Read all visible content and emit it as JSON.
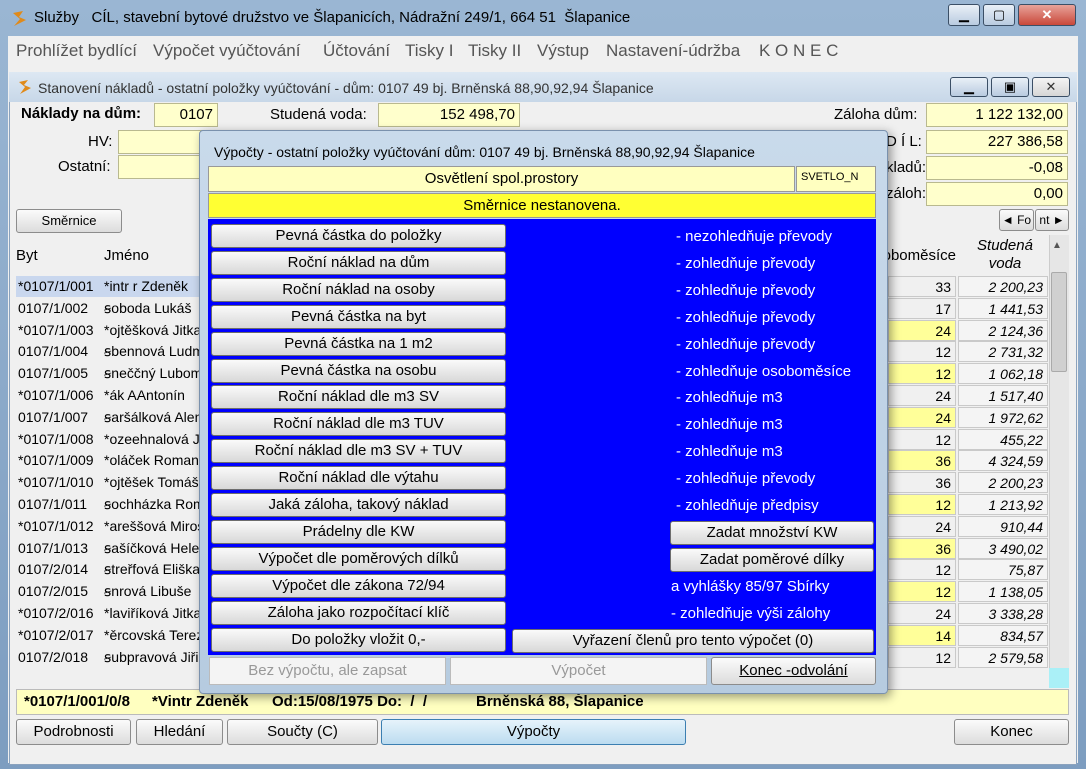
{
  "outer": {
    "title": "Služby   CÍL, stavební bytové družstvo ve Šlapanicích, Nádražní 249/1, 664 51  Šlapanice"
  },
  "menu": [
    "Prohlížet bydlící",
    "Výpočet vyúčtování",
    "Účtování",
    "Tisky I",
    "Tisky II",
    "Výstup",
    "Nastavení-údržba",
    "K O N E C"
  ],
  "inner": {
    "title": "Stanovení nákladů - ostatní položky vyúčtování - dům: 0107  49 bj. Brněnská 88,90,92,94 Šlapanice"
  },
  "form": {
    "naklady_label": "Náklady na dům:",
    "naklady_value": "0107",
    "studena_label": "Studená voda:",
    "studena_value": "152 498,70",
    "zaloha_label": "Záloha dům:",
    "zaloha_value": "1 122 132,00",
    "hv_label": "HV:",
    "ostatni_label": "Ostatní:",
    "r2_label": "D Í L:",
    "r2_value": "227 386,58",
    "r3_label": "kladů:",
    "r3_value": "-0,08",
    "r4_label": "záloh:",
    "r4_value": "0,00",
    "smernice_button": "Směrnice",
    "nav_prev": "◄ Fo",
    "nav_next": "nt ►"
  },
  "table": {
    "headers": {
      "byt": "Byt",
      "jmeno": "Jméno",
      "osobomesice": "Osoboměsíce",
      "studena1": "Studená",
      "studena2": "voda"
    },
    "rows": [
      {
        "byt": "*0107/1/001",
        "jmeno": "*intr r Zdeněk",
        "os": "33",
        "sv": "2 200,23",
        "hl": false
      },
      {
        "byt": "0107/1/002",
        "jmeno": "ꞩoboda Lukáš",
        "os": "17",
        "sv": "1 441,53",
        "hl": false
      },
      {
        "byt": "*0107/1/003",
        "jmeno": "*ojtěšková Jitka",
        "os": "24",
        "sv": "2 124,36",
        "hl": true
      },
      {
        "byt": "0107/1/004",
        "jmeno": "ꞩbennová Ludmila",
        "os": "12",
        "sv": "2 731,32",
        "hl": false
      },
      {
        "byt": "0107/1/005",
        "jmeno": "ꞩneččný Lubomír",
        "os": "12",
        "sv": "1 062,18",
        "hl": true
      },
      {
        "byt": "*0107/1/006",
        "jmeno": "*ák AAntonín",
        "os": "24",
        "sv": "1 517,40",
        "hl": false
      },
      {
        "byt": "0107/1/007",
        "jmeno": "ꞩaršálková Alena",
        "os": "24",
        "sv": "1 972,62",
        "hl": true
      },
      {
        "byt": "*0107/1/008",
        "jmeno": "*ozeehnalová Jana",
        "os": "12",
        "sv": "455,22",
        "hl": false
      },
      {
        "byt": "*0107/1/009",
        "jmeno": "*oláček Roman",
        "os": "36",
        "sv": "4 324,59",
        "hl": true
      },
      {
        "byt": "*0107/1/010",
        "jmeno": "*ojtěšek Tomáš",
        "os": "36",
        "sv": "2 200,23",
        "hl": false
      },
      {
        "byt": "0107/1/011",
        "jmeno": "ꞩochházka Roman",
        "os": "12",
        "sv": "1 213,92",
        "hl": true
      },
      {
        "byt": "*0107/1/012",
        "jmeno": "*areššová Miroslava",
        "os": "24",
        "sv": "910,44",
        "hl": false
      },
      {
        "byt": "0107/1/013",
        "jmeno": "ꞩašíčková Helena",
        "os": "36",
        "sv": "3 490,02",
        "hl": true
      },
      {
        "byt": "0107/2/014",
        "jmeno": "ꞩtreřfová Eliška",
        "os": "12",
        "sv": "75,87",
        "hl": false
      },
      {
        "byt": "0107/2/015",
        "jmeno": "ꞩnrová Libuše",
        "os": "12",
        "sv": "1 138,05",
        "hl": true
      },
      {
        "byt": "*0107/2/016",
        "jmeno": "*laviříková Jitka",
        "os": "24",
        "sv": "3 338,28",
        "hl": false
      },
      {
        "byt": "*0107/2/017",
        "jmeno": "*ěrcovská Tereza",
        "os": "14",
        "sv": "834,57",
        "hl": true
      },
      {
        "byt": "0107/2/018",
        "jmeno": "ꞩubpravová Jiřina",
        "os": "12",
        "sv": "2 579,58",
        "hl": false
      }
    ]
  },
  "status": {
    "byt": "*0107/1/001/0/8",
    "jmeno": "*Vintr Zdeněk",
    "od": "Od:15/08/1975 Do:  /  /",
    "adresa": "Brněnská 88, Šlapanice"
  },
  "bottom": {
    "podrobnosti": "Podrobnosti",
    "hledani": "Hledání",
    "soucty": "Součty (C)",
    "vypocty": "Výpočty",
    "konec": "Konec"
  },
  "dialog": {
    "title": "Výpočty - ostatní položky vyúčtování dům: 0107  49 bj. Brněnská 88,90,92,94 Šlapanice",
    "item": "Osvětlení spol.prostory",
    "code": "SVETLO_N",
    "warning": "Směrnice nestanovena.",
    "buttons": [
      "Pevná částka do položky",
      "Roční náklad na dům",
      "Roční náklad na osoby",
      "Pevná částka na byt",
      "Pevná částka na 1 m2",
      "Pevná částka na osobu",
      "Roční náklad dle m3 SV",
      "Roční náklad dle m3 TUV",
      "Roční náklad dle m3 SV + TUV",
      "Roční náklad dle výtahu",
      "Jaká záloha, takový náklad",
      "Prádelny dle KW",
      "Výpočet dle poměrových dílků",
      "Výpočet dle zákona 72/94",
      "Záloha jako rozpočítací klíč",
      "Do položky vložit 0,-"
    ],
    "notes": [
      "- nezohledňuje převody",
      "- zohledňuje převody",
      "- zohledňuje převody",
      "- zohledňuje převody",
      "- zohledňuje převody",
      "- zohledňuje osoboměsíce",
      "- zohledňuje m3",
      "- zohledňuje m3",
      "- zohledňuje m3",
      "- zohledňuje převody",
      "- zohledňuje předpisy"
    ],
    "zadat_kw": "Zadat množství KW",
    "zadat_dilky": "Zadat poměrové dílky",
    "note_vyhlasky": "a vyhlášky 85/97 Sbírky",
    "note_zaloha": "- zohledňuje výši zálohy",
    "vyrazeni": "Vyřazení členů pro tento výpočet (0)",
    "bez_vypoctu": "Bez výpočtu, ale zapsat",
    "vypocet": "Výpočet",
    "konec_odvolani": "Konec -odvolání"
  }
}
